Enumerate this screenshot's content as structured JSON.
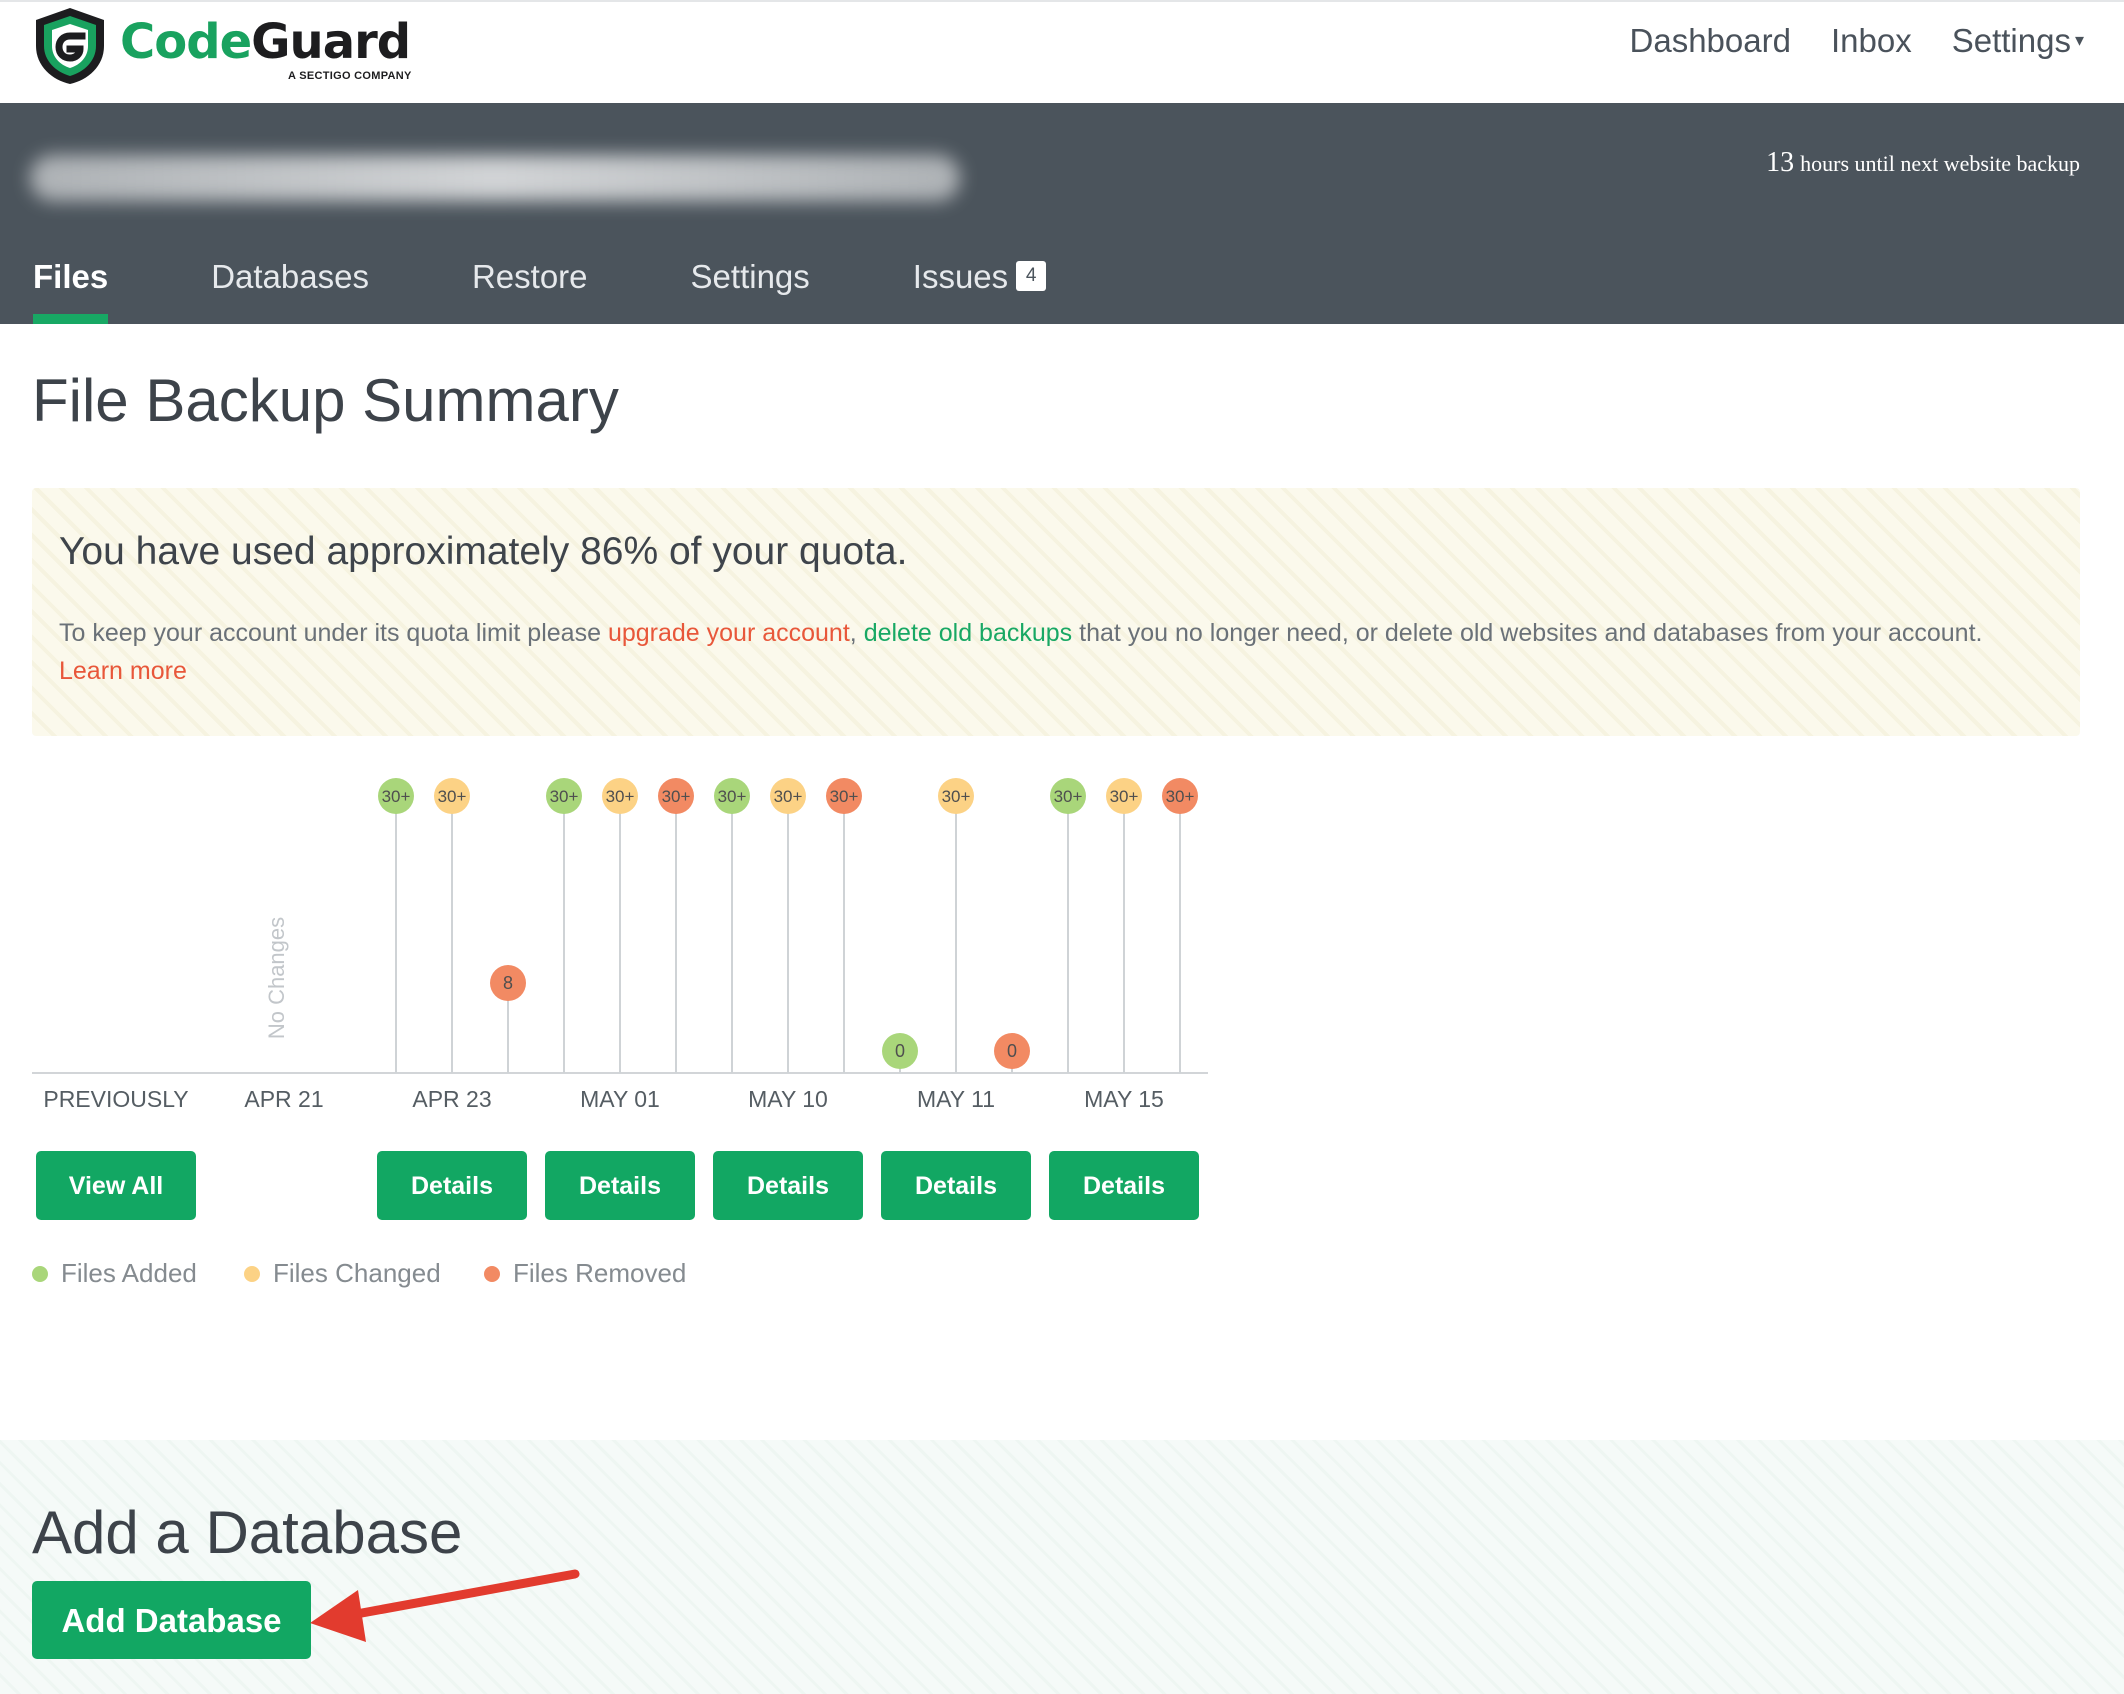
{
  "brand": {
    "name_part1": "Code",
    "name_part2": "Guard",
    "tagline": "A SECTIGO COMPANY",
    "colors": {
      "green": "#19a25f",
      "dark": "#1d1d1f"
    }
  },
  "topnav": {
    "items": [
      {
        "label": "Dashboard"
      },
      {
        "label": "Inbox"
      },
      {
        "label": "Settings"
      }
    ],
    "settings_caret": "▾"
  },
  "site_header": {
    "backup_countdown_num": "13",
    "backup_countdown_text": "hours until next website backup",
    "tabs": [
      {
        "label": "Files",
        "active": true
      },
      {
        "label": "Databases",
        "active": false
      },
      {
        "label": "Restore",
        "active": false
      },
      {
        "label": "Settings",
        "active": false
      },
      {
        "label": "Issues",
        "active": false,
        "badge": "4"
      }
    ],
    "colors": {
      "background": "#4b545c",
      "active_underline": "#18a864"
    }
  },
  "main": {
    "title": "File Backup Summary",
    "quota": {
      "title": "You have used approximately 86% of your quota.",
      "text_1": "To keep your account under its quota limit please ",
      "link_upgrade": "upgrade your account",
      "text_2": ", ",
      "link_delete": "delete old backups",
      "text_3": " that you no longer need, or delete old websites and databases from your account. ",
      "link_learn": "Learn more"
    }
  },
  "chart_data": {
    "type": "timeline",
    "no_changes_label": "No Changes",
    "categories": [
      "PREVIOUSLY",
      "APR 21",
      "APR 23",
      "MAY 01",
      "MAY 10",
      "MAY 11",
      "MAY 15"
    ],
    "series_colors": {
      "added": "#a9d67a",
      "changed": "#fcd285",
      "removed": "#f28a63"
    },
    "points": [
      {
        "group": "APR 23",
        "type": "added",
        "label": "30+"
      },
      {
        "group": "APR 23",
        "type": "changed",
        "label": "30+"
      },
      {
        "group": "APR 23",
        "type": "removed",
        "label": "8"
      },
      {
        "group": "MAY 01",
        "type": "added",
        "label": "30+"
      },
      {
        "group": "MAY 01",
        "type": "changed",
        "label": "30+"
      },
      {
        "group": "MAY 01",
        "type": "removed",
        "label": "30+"
      },
      {
        "group": "MAY 10",
        "type": "added",
        "label": "30+"
      },
      {
        "group": "MAY 10",
        "type": "changed",
        "label": "30+"
      },
      {
        "group": "MAY 10",
        "type": "removed",
        "label": "30+"
      },
      {
        "group": "MAY 11",
        "type": "added",
        "label": "0"
      },
      {
        "group": "MAY 11",
        "type": "changed",
        "label": "30+"
      },
      {
        "group": "MAY 11",
        "type": "removed",
        "label": "0"
      },
      {
        "group": "MAY 15",
        "type": "added",
        "label": "30+"
      },
      {
        "group": "MAY 15",
        "type": "changed",
        "label": "30+"
      },
      {
        "group": "MAY 15",
        "type": "removed",
        "label": "30+"
      }
    ],
    "legend": [
      {
        "name": "Files Added",
        "color": "#a9d67a"
      },
      {
        "name": "Files Changed",
        "color": "#fcd285"
      },
      {
        "name": "Files Removed",
        "color": "#f28a63"
      }
    ]
  },
  "buttons": {
    "view_all": "View All",
    "details": "Details",
    "color": "#12a763"
  },
  "add_database": {
    "title": "Add a Database",
    "button": "Add Database",
    "arrow_color": "#e23b2e"
  }
}
